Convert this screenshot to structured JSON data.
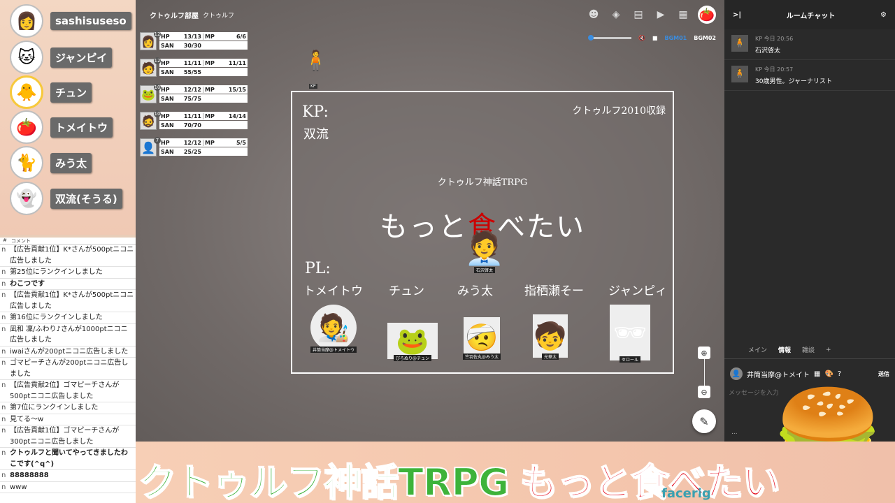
{
  "participants": [
    {
      "name": "sashisuseso",
      "icon": "👩"
    },
    {
      "name": "ジャンピイ",
      "icon": "🐱"
    },
    {
      "name": "チュン",
      "icon": "🐥"
    },
    {
      "name": "トメイトウ",
      "icon": "🍅"
    },
    {
      "name": "みう太",
      "icon": "🐈"
    },
    {
      "name": "双流(そうる)",
      "icon": "👻"
    }
  ],
  "comments": {
    "header": "コメント",
    "rows": [
      {
        "user": "n",
        "text": "【広告貢献1位】K*さんが500ptニコニ広告しました",
        "bold": false
      },
      {
        "user": "n",
        "text": "第25位にランクインしました",
        "bold": false
      },
      {
        "user": "n",
        "text": "わこつです",
        "bold": true
      },
      {
        "user": "n",
        "text": "【広告貢献1位】K*さんが500ptニコニ広告しました",
        "bold": false
      },
      {
        "user": "n",
        "text": "第16位にランクインしました",
        "bold": false
      },
      {
        "user": "n",
        "text": "凪和 凜/ふわり♪さんが1000ptニコニ広告しました",
        "bold": false
      },
      {
        "user": "n",
        "text": "iwaiさんが200ptニコニ広告しました",
        "bold": false
      },
      {
        "user": "n",
        "text": "ゴマピーチさんが200ptニコニ広告しました",
        "bold": false
      },
      {
        "user": "n",
        "text": "【広告貢献2位】ゴマピーチさんが500ptニコニ広告しました",
        "bold": false
      },
      {
        "user": "n",
        "text": "第7位にランクインしました",
        "bold": false
      },
      {
        "user": "n",
        "text": "見てる～w",
        "bold": false
      },
      {
        "user": "n",
        "text": "【広告貢献1位】ゴマピーチさんが300ptニコニ広告しました",
        "bold": false
      },
      {
        "user": "n",
        "text": "クトゥルフと聞いてやってきましたわこです(^q^)",
        "bold": true
      },
      {
        "user": "n",
        "text": "88888888",
        "bold": true
      },
      {
        "user": "n",
        "text": "www",
        "bold": false
      }
    ]
  },
  "room": {
    "name": "クトゥルフ部屋",
    "sub": "クトゥルフ"
  },
  "bgm": {
    "label1": "BGM01",
    "label2": "BGM02",
    "volume": 0.0
  },
  "characters": [
    {
      "level": "12",
      "hp": "13/13",
      "mp": "6/6",
      "san": "30/30",
      "icon": "👩"
    },
    {
      "level": "12",
      "hp": "11/11",
      "mp": "11/11",
      "san": "55/55",
      "icon": "🧑"
    },
    {
      "level": "10",
      "hp": "12/12",
      "mp": "15/15",
      "san": "75/75",
      "icon": "🐸"
    },
    {
      "level": "10",
      "hp": "11/11",
      "mp": "14/14",
      "san": "70/70",
      "icon": "🧔"
    },
    {
      "level": "7",
      "hp": "12/12",
      "mp": "5/5",
      "san": "25/25",
      "icon": "👤"
    }
  ],
  "stat_labels": {
    "hp": "HP",
    "mp": "MP",
    "san": "SAN"
  },
  "kp_token": {
    "label": "KP",
    "icon": "🧍"
  },
  "card": {
    "kp_label": "KP:",
    "kp_name": "双流",
    "record": "クトゥルフ2010収録",
    "game": "クトゥルフ神話TRPG",
    "title_pre": "もっと",
    "title_red": "食",
    "title_post": "べたい",
    "pl_label": "PL:",
    "pl_names": [
      "トメイトウ",
      "チュン",
      "みう太",
      "指栖瀬そー",
      "ジャンピィ"
    ],
    "center_token_caption": "石沢啓太",
    "portraits": [
      {
        "caption": "井筒当摩@トメイトウ",
        "icon": "🧑‍🎨"
      },
      {
        "caption": "ぴろぬり@チュン",
        "icon": "🐸"
      },
      {
        "caption": "竺羽佐丸@みう太",
        "icon": "🤕"
      },
      {
        "caption": "光華太",
        "icon": "🧒"
      },
      {
        "caption": "セロール",
        "icon": "🕶"
      }
    ]
  },
  "chat": {
    "title": "ルームチャット",
    "messages": [
      {
        "sender": "KP",
        "time": "今日 20:56",
        "text": "石沢啓太"
      },
      {
        "sender": "KP",
        "time": "今日 20:57",
        "text": "30歳男性。ジャーナリスト"
      }
    ],
    "tabs": [
      "メイン",
      "情報",
      "雑談",
      "+"
    ],
    "active_tab": "情報",
    "sender_name": "井筒当摩@トメイト",
    "send_label": "送信",
    "placeholder": "メッセージを入力",
    "bottom": "..."
  },
  "banner": {
    "green": "クトゥルフ神話TRPG",
    "red": "もっと食べたい",
    "facerig": "facerig"
  },
  "colors": {
    "banner_green": "#3db33a",
    "banner_red": "#e20012",
    "accent": "#3a8de0"
  }
}
